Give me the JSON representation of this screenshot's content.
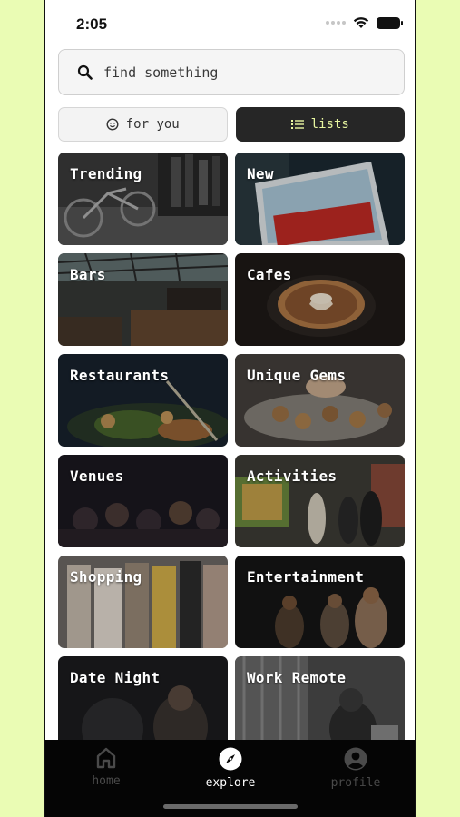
{
  "status": {
    "time": "2:05"
  },
  "search": {
    "placeholder": "find something"
  },
  "tabs": [
    {
      "label": "for you",
      "icon": "smiley-icon",
      "active": false
    },
    {
      "label": "lists",
      "icon": "list-icon",
      "active": true
    }
  ],
  "categories": [
    {
      "label": "Trending",
      "image": "people-queue-bicycle"
    },
    {
      "label": "New",
      "image": "come-on-in-open-sign"
    },
    {
      "label": "Bars",
      "image": "indoor-bar-skylight"
    },
    {
      "label": "Cafes",
      "image": "latte-art-coffee"
    },
    {
      "label": "Restaurants",
      "image": "plated-food-skewers"
    },
    {
      "label": "Unique Gems",
      "image": "pastry-trays-hands"
    },
    {
      "label": "Venues",
      "image": "crowd-concert"
    },
    {
      "label": "Activities",
      "image": "art-gallery-people"
    },
    {
      "label": "Shopping",
      "image": "clothing-rack"
    },
    {
      "label": "Entertainment",
      "image": "live-band-stage"
    },
    {
      "label": "Date Night",
      "image": "couple-dinner"
    },
    {
      "label": "Work Remote",
      "image": "person-laptop-window"
    }
  ],
  "nav": [
    {
      "label": "home",
      "icon": "home-icon",
      "active": false
    },
    {
      "label": "explore",
      "icon": "compass-icon",
      "active": true
    },
    {
      "label": "profile",
      "icon": "user-circle-icon",
      "active": false
    }
  ],
  "colors": {
    "background": "#eafcb4",
    "active_tab": "#262626",
    "active_tab_text": "#e8f6a0",
    "nav_bg": "#050505"
  }
}
